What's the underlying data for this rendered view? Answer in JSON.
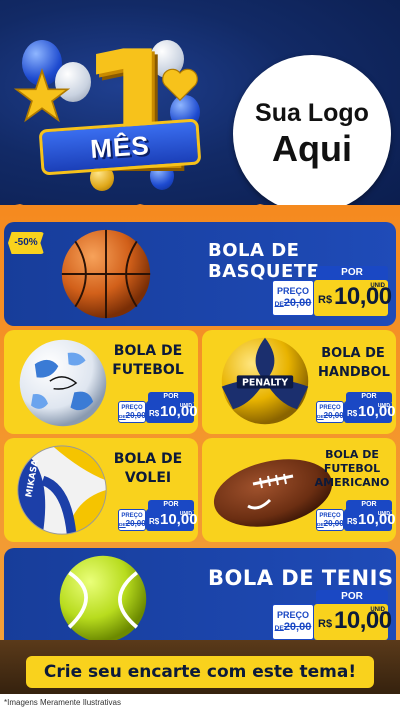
{
  "header": {
    "number": "1",
    "ribbon": "MÊS",
    "logo_line1": "Sua Logo",
    "logo_line2": "Aqui"
  },
  "currency": "R$",
  "products": {
    "basquete": {
      "discount": "-50%",
      "title": "BOLA DE BASQUETE",
      "por": "POR",
      "preco": "PREÇO",
      "old_prefix": "DE",
      "old_price": "20,00",
      "new_price": "10,00",
      "unid": "UNID"
    },
    "futebol": {
      "title_line1": "BOLA DE",
      "title_line2": "FUTEBOL",
      "por": "POR",
      "preco": "PREÇO",
      "old_prefix": "DE",
      "old_price": "20,00",
      "new_price": "10,00",
      "unid": "UNID"
    },
    "handbol": {
      "title_line1": "BOLA DE",
      "title_line2": "HANDBOL",
      "por": "POR",
      "preco": "PREÇO",
      "old_prefix": "DE",
      "old_price": "20,00",
      "new_price": "10,00",
      "unid": "UNID"
    },
    "volei": {
      "title_line1": "BOLA DE",
      "title_line2": "VOLEI",
      "por": "POR",
      "preco": "PREÇO",
      "old_prefix": "DE",
      "old_price": "20,00",
      "new_price": "10,00",
      "unid": "UNID"
    },
    "americano": {
      "title_line1": "BOLA DE",
      "title_line2": "FUTEBOL",
      "title_line3": "AMERICANO",
      "por": "POR",
      "preco": "PREÇO",
      "old_prefix": "DE",
      "old_price": "20,00",
      "new_price": "10,00",
      "unid": "UNID"
    },
    "tenis": {
      "title": "BOLA DE TENIS",
      "por": "POR",
      "preco": "PREÇO",
      "old_prefix": "DE",
      "old_price": "20,00",
      "new_price": "10,00",
      "unid": "UNID"
    }
  },
  "balls": {
    "basquete": "basketball-icon",
    "futebol": "soccer-ball-icon",
    "handbol": "handball-icon",
    "handbol_brand": "PENALTY",
    "volei": "volleyball-icon",
    "volei_brand": "MIKASA",
    "americano": "football-icon",
    "tenis": "tennis-ball-icon"
  },
  "cta": "Crie seu encarte com este tema!",
  "disclaimer": "*Imagens Meramente Ilustrativas",
  "colors": {
    "navy": "#0b1d4d",
    "blue": "#1a48c4",
    "yellow": "#f9d21d",
    "orange": "#f58a1f"
  }
}
